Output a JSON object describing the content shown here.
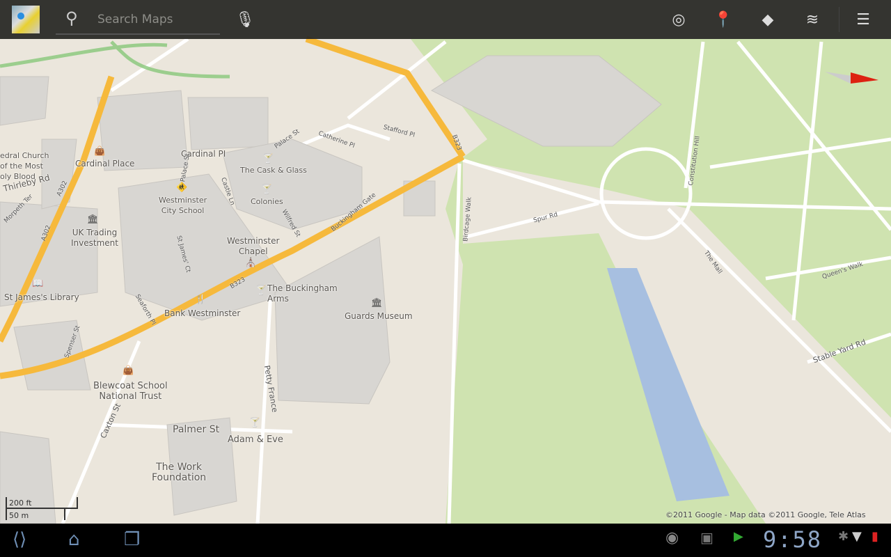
{
  "topbar": {
    "search_placeholder": "Search Maps",
    "icons": [
      "maps-logo-icon",
      "search-icon",
      "microphone-icon",
      "my-location-icon",
      "places-pin-icon",
      "directions-icon",
      "layers-icon",
      "menu-icon"
    ]
  },
  "map": {
    "labels": [
      "Cardinal PI",
      "Cardinal Place",
      "edral Church\nof the Most\noly Blood",
      "Thirleby Rd",
      "The Cask & Glass",
      "Colonies",
      "Westminster\nCity School",
      "UK Trading\nInvestment",
      "Westminster\nChapel",
      "St James's Library",
      "The Buckingham\nArms",
      "Guards Museum",
      "Bank Westminster",
      "Blewcoat School\nNational Trust",
      "Palmer St",
      "Adam & Eve",
      "The Work\nFoundation"
    ],
    "streets": [
      "A302",
      "Buckingham Gate",
      "B323",
      "B323",
      "Petty France",
      "Caxton St",
      "Birdcage Walk",
      "Spur Rd",
      "The Mall",
      "Queen's Walk",
      "Stable Yard Rd",
      "Constitution Hill",
      "Stafford Pl",
      "Palace St",
      "Catherine Pl",
      "Castle Ln",
      "St James' Ct",
      "Seaforth Pl",
      "Spenser St",
      "Wilfred St",
      "Palace St",
      "A302",
      "Morpeth Ter"
    ],
    "colors": {
      "land": "#ebe6dc",
      "park": "#cfe3b0",
      "water": "#a7bfe0",
      "major_road": "#f6b93c",
      "building": "#d8d6d2"
    }
  },
  "scale": {
    "imperial": "200 ft",
    "metric": "50 m"
  },
  "copyright": "©2011 Google - Map data ©2011 Google, Tele Atlas",
  "statusbar": {
    "time": "9:58",
    "icons": [
      "gps-icon",
      "android-debug-icon",
      "media-icon",
      "bluetooth-icon",
      "signal-icon",
      "battery-low-icon"
    ]
  },
  "navbar": {
    "icons": [
      "back-icon",
      "home-icon",
      "recent-apps-icon"
    ]
  }
}
